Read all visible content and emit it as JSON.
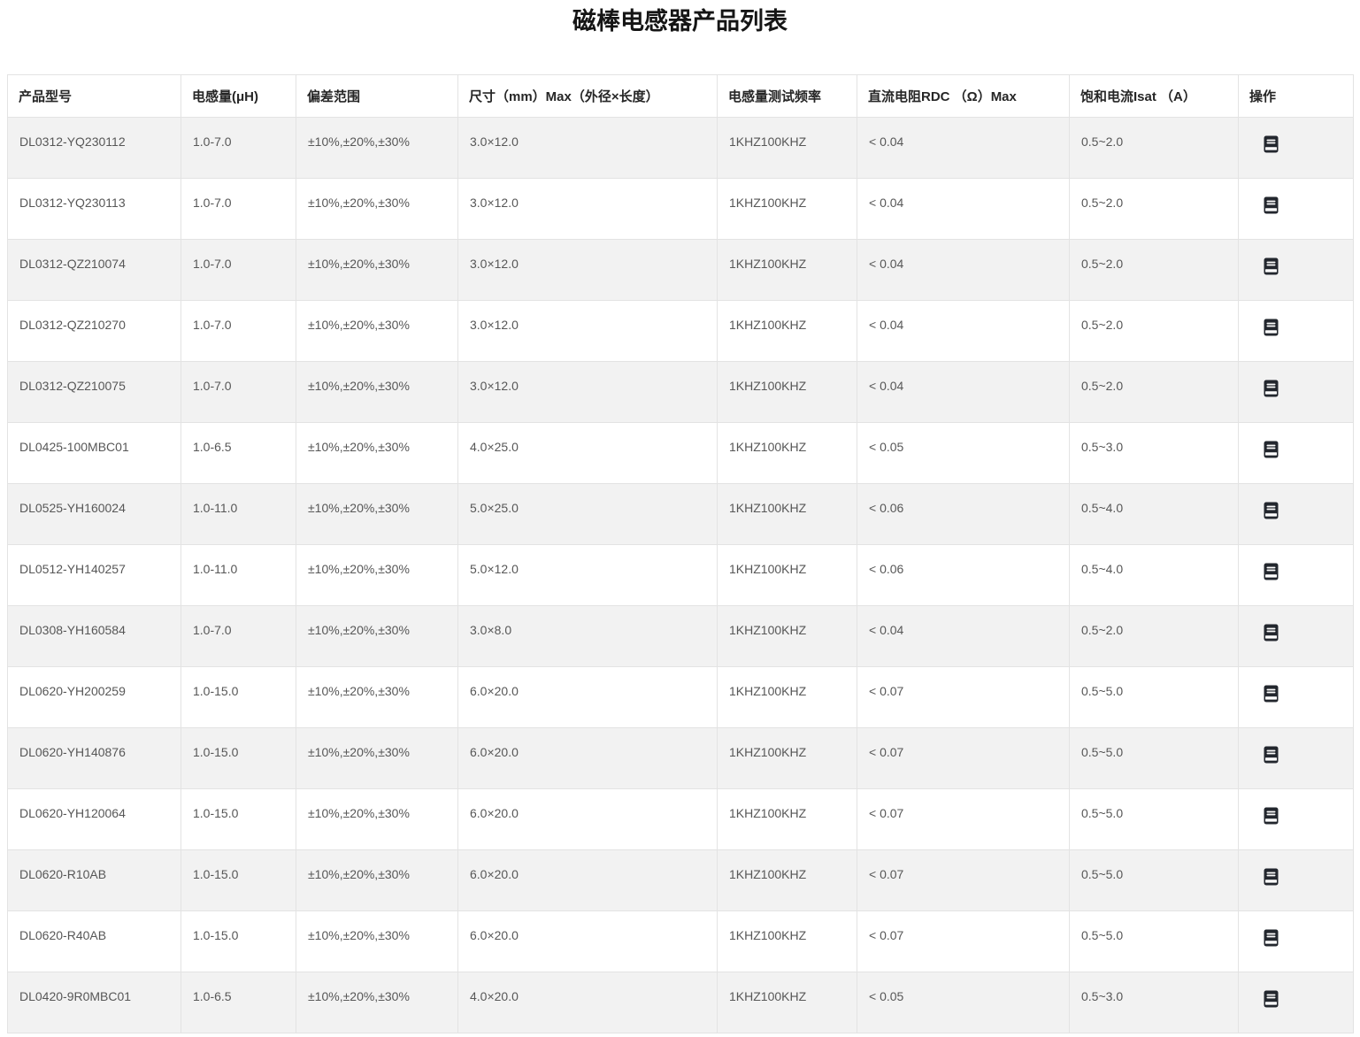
{
  "page": {
    "title": "磁棒电感器产品列表"
  },
  "table": {
    "columns": [
      {
        "key": "model",
        "label": "产品型号"
      },
      {
        "key": "inductance",
        "label": "电感量(μH)"
      },
      {
        "key": "tolerance",
        "label": "偏差范围"
      },
      {
        "key": "size",
        "label": "尺寸（mm）Max（外径×长度）"
      },
      {
        "key": "freq",
        "label": "电感量测试频率"
      },
      {
        "key": "rdc",
        "label": "直流电阻RDC （Ω）Max"
      },
      {
        "key": "isat",
        "label": "饱和电流Isat （A）"
      },
      {
        "key": "action",
        "label": "操作"
      }
    ],
    "action_icon": "datasheet-icon",
    "rows": [
      {
        "model": "DL0312-YQ230112",
        "inductance": "1.0-7.0",
        "tolerance": "±10%,±20%,±30%",
        "size": "3.0×12.0",
        "freq": "1KHZ100KHZ",
        "rdc": "< 0.04",
        "isat": "0.5~2.0"
      },
      {
        "model": "DL0312-YQ230113",
        "inductance": "1.0-7.0",
        "tolerance": "±10%,±20%,±30%",
        "size": "3.0×12.0",
        "freq": "1KHZ100KHZ",
        "rdc": "< 0.04",
        "isat": "0.5~2.0"
      },
      {
        "model": "DL0312-QZ210074",
        "inductance": "1.0-7.0",
        "tolerance": "±10%,±20%,±30%",
        "size": "3.0×12.0",
        "freq": "1KHZ100KHZ",
        "rdc": "< 0.04",
        "isat": "0.5~2.0"
      },
      {
        "model": "DL0312-QZ210270",
        "inductance": "1.0-7.0",
        "tolerance": "±10%,±20%,±30%",
        "size": "3.0×12.0",
        "freq": "1KHZ100KHZ",
        "rdc": "< 0.04",
        "isat": "0.5~2.0"
      },
      {
        "model": "DL0312-QZ210075",
        "inductance": "1.0-7.0",
        "tolerance": "±10%,±20%,±30%",
        "size": "3.0×12.0",
        "freq": "1KHZ100KHZ",
        "rdc": "< 0.04",
        "isat": "0.5~2.0"
      },
      {
        "model": "DL0425-100MBC01",
        "inductance": "1.0-6.5",
        "tolerance": "±10%,±20%,±30%",
        "size": "4.0×25.0",
        "freq": "1KHZ100KHZ",
        "rdc": "< 0.05",
        "isat": "0.5~3.0"
      },
      {
        "model": "DL0525-YH160024",
        "inductance": "1.0-11.0",
        "tolerance": "±10%,±20%,±30%",
        "size": "5.0×25.0",
        "freq": "1KHZ100KHZ",
        "rdc": "< 0.06",
        "isat": "0.5~4.0"
      },
      {
        "model": "DL0512-YH140257",
        "inductance": "1.0-11.0",
        "tolerance": "±10%,±20%,±30%",
        "size": "5.0×12.0",
        "freq": "1KHZ100KHZ",
        "rdc": "< 0.06",
        "isat": "0.5~4.0"
      },
      {
        "model": "DL0308-YH160584",
        "inductance": "1.0-7.0",
        "tolerance": "±10%,±20%,±30%",
        "size": "3.0×8.0",
        "freq": "1KHZ100KHZ",
        "rdc": "< 0.04",
        "isat": "0.5~2.0"
      },
      {
        "model": "DL0620-YH200259",
        "inductance": "1.0-15.0",
        "tolerance": "±10%,±20%,±30%",
        "size": "6.0×20.0",
        "freq": "1KHZ100KHZ",
        "rdc": "< 0.07",
        "isat": "0.5~5.0"
      },
      {
        "model": "DL0620-YH140876",
        "inductance": "1.0-15.0",
        "tolerance": "±10%,±20%,±30%",
        "size": "6.0×20.0",
        "freq": "1KHZ100KHZ",
        "rdc": "< 0.07",
        "isat": "0.5~5.0"
      },
      {
        "model": "DL0620-YH120064",
        "inductance": "1.0-15.0",
        "tolerance": "±10%,±20%,±30%",
        "size": "6.0×20.0",
        "freq": "1KHZ100KHZ",
        "rdc": "< 0.07",
        "isat": "0.5~5.0"
      },
      {
        "model": "DL0620-R10AB",
        "inductance": "1.0-15.0",
        "tolerance": "±10%,±20%,±30%",
        "size": "6.0×20.0",
        "freq": "1KHZ100KHZ",
        "rdc": "< 0.07",
        "isat": "0.5~5.0"
      },
      {
        "model": "DL0620-R40AB",
        "inductance": "1.0-15.0",
        "tolerance": "±10%,±20%,±30%",
        "size": "6.0×20.0",
        "freq": "1KHZ100KHZ",
        "rdc": "< 0.07",
        "isat": "0.5~5.0"
      },
      {
        "model": "DL0420-9R0MBC01",
        "inductance": "1.0-6.5",
        "tolerance": "±10%,±20%,±30%",
        "size": "4.0×20.0",
        "freq": "1KHZ100KHZ",
        "rdc": "< 0.05",
        "isat": "0.5~3.0"
      }
    ]
  },
  "colors": {
    "row_stripe": "#f2f2f2",
    "border": "#e3e3e3",
    "header_text": "#262626",
    "cell_text": "#575757",
    "icon": "#23272e"
  }
}
